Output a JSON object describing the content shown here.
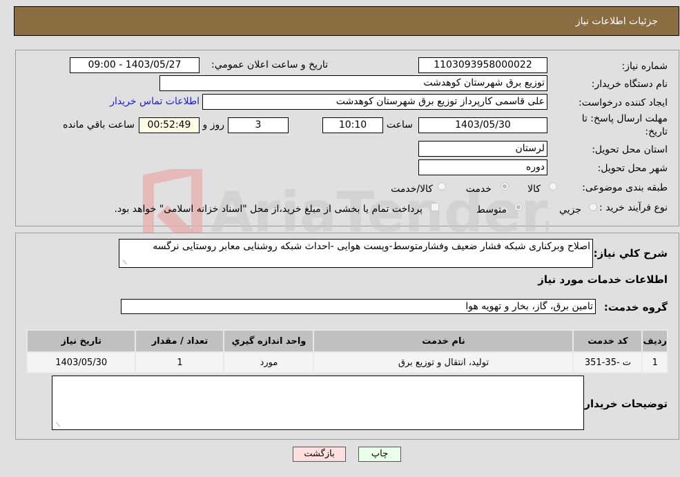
{
  "header": {
    "title": "جزئیات اطلاعات نیاز"
  },
  "details": {
    "need_number": {
      "label": "شماره نیاز:",
      "value": "1103093958000022"
    },
    "announce_datetime": {
      "label": "تاریخ و ساعت اعلان عمومي:",
      "value": "1403/05/27 - 09:00"
    },
    "buyer_org": {
      "label": "نام دستگاه خريدار:",
      "value": "توزیع برق شهرستان کوهدشت"
    },
    "requester": {
      "label": "ايجاد کننده درخواست:",
      "value": "علی قاسمی کارپرداز توزیع برق شهرستان کوهدشت",
      "contact_link": "اطلاعات تماس خريدار"
    },
    "deadline": {
      "label_line1": "مهلت ارسال پاسخ: تا",
      "label_line2": "تاریخ:",
      "date": "1403/05/30",
      "time_label": "ساعت",
      "time": "10:10",
      "days": "3",
      "days_label": "روز و",
      "remaining": "00:52:49",
      "remaining_label": "ساعت باقي مانده"
    },
    "province": {
      "label": "استان محل تحویل:",
      "value": "لرستان"
    },
    "city": {
      "label": "شهر محل تحویل:",
      "value": "دوره"
    },
    "category": {
      "label": "طبقه بندی موضوعی:",
      "options": [
        "کالا",
        "خدمت",
        "کالا/خدمت"
      ],
      "selected": "خدمت"
    },
    "purchase_type": {
      "label": "نوع فرآیند خرید :",
      "options": [
        "جزيي",
        "متوسط"
      ],
      "selected": "متوسط",
      "treasury_note": "پرداخت تمام یا بخشی از مبلغ خرید،از محل \"اسناد خزانه اسلامی\" خواهد بود."
    }
  },
  "description": {
    "label": "شرح کلي نياز:",
    "value": "اصلاح وبرکناری شبکه فشار ضعیف وفشارمتوسط-وپست هوایی -احداث شبکه روشنایی معابر روستایی نرگسه"
  },
  "services": {
    "section_title": "اطلاعات خدمات مورد نياز",
    "group_label": "گروه خدمت:",
    "group_value": "تامین برق، گاز، بخار و تهویه هوا",
    "table": {
      "headers": [
        "رديف",
        "کد خدمت",
        "نام خدمت",
        "واحد اندازه گيري",
        "تعداد / مقدار",
        "تاريخ نياز"
      ],
      "rows": [
        [
          "1",
          "ت -35-351",
          "تولید، انتقال و توزیع برق",
          "مورد",
          "1",
          "1403/05/30"
        ]
      ]
    }
  },
  "buyer_notes": {
    "label": "توضيحات خريدار:",
    "value": ""
  },
  "buttons": {
    "print": "چاپ",
    "back": "بازگشت"
  },
  "watermark": {
    "text": "AriaTender.neT"
  },
  "colors": {
    "header_bg": "#8b6d42",
    "print_bg": "#eaffea",
    "back_bg": "#ffe0e0",
    "remaining_bg": "#ffffe6",
    "link": "#1a1ae0"
  }
}
